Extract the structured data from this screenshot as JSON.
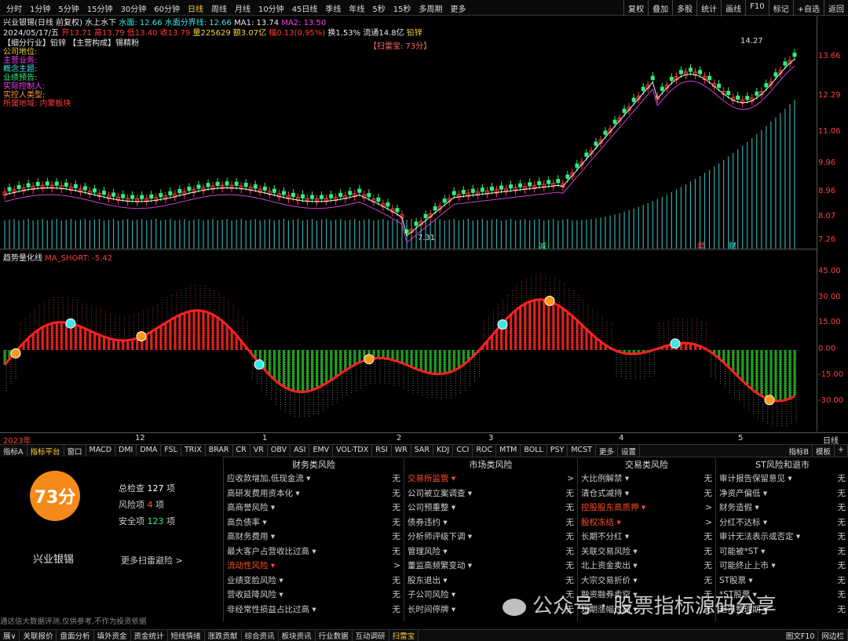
{
  "toolbar": {
    "periods": [
      "分时",
      "1分钟",
      "5分钟",
      "15分钟",
      "30分钟",
      "60分钟",
      "日线",
      "周线",
      "月线",
      "10分钟",
      "45日线",
      "季线",
      "年线",
      "5秒",
      "15秒",
      "多周期",
      "更多"
    ],
    "active_period": "日线",
    "right_buttons": [
      "复权",
      "叠加",
      "多股",
      "统计",
      "画线",
      "F10",
      "标记",
      "+自选",
      "返回"
    ]
  },
  "info1": {
    "stock": "兴业银锡(日线 前复权)",
    "indicator": "水上水下",
    "water_label": "水面: 12.66",
    "boundary_label": "水面分界线: 12.66",
    "ma1": "MA1: 13.74",
    "ma2": "MA2: 13.50"
  },
  "info2": {
    "date": "2024/05/17/五",
    "open": "开13.71",
    "high": "高13.79",
    "low": "低13.40",
    "close": "收13.79",
    "volume": "量225629",
    "amount": "额3.07亿",
    "change": "幅0.13(0.95%)",
    "turnover": "换1.53%",
    "float": "流通14.8亿",
    "tag": "铅锌"
  },
  "overlay": {
    "industry": "【细分行业】铅锌 【主营构成】锡精粉",
    "lines": [
      "公司地位:",
      "主营业务:",
      "概念主题:",
      "业绩预告:",
      "实际控制人:",
      "实控人类型:",
      "所属地域: 内蒙板块"
    ],
    "scan_badge": "【扫雷宝: 73分】",
    "high_label": "14.27",
    "low_label": "7.31",
    "markers": [
      "减",
      "增",
      "财"
    ]
  },
  "price_axis": [
    "13.66",
    "12.29",
    "11.06",
    "9.96",
    "8.96",
    "8.07",
    "7.26"
  ],
  "osc": {
    "title": "趋势量化线",
    "param": "MA_SHORT: -5.42",
    "axis": [
      "45.00",
      "30.00",
      "15.00",
      "0.00",
      "-15.00",
      "-30.00"
    ]
  },
  "date_row": {
    "labels": [
      "2023年",
      "12",
      "1",
      "2",
      "3",
      "4",
      "5"
    ],
    "right": "日线"
  },
  "index_tabs": {
    "left": [
      "指标A",
      "指标平台",
      "窗口",
      "MACD",
      "DMI",
      "DMA",
      "FSL",
      "TRIX",
      "BRAR",
      "CR",
      "VR",
      "OBV",
      "ASI",
      "EMV",
      "VOL-TDX",
      "RSI",
      "WR",
      "SAR",
      "KDJ",
      "CCI",
      "ROC",
      "MTM",
      "BOLL",
      "PSY",
      "MCST",
      "更多",
      "设置"
    ],
    "active": "指标平台",
    "right": [
      "指标B",
      "模板",
      "+"
    ]
  },
  "score": {
    "value": "73分",
    "name": "兴业银锡",
    "total_label": "总检查",
    "total": "127",
    "risk_label": "风险项",
    "risk": "4",
    "safe_label": "安全项",
    "safe": "123",
    "unit": "项",
    "more": "更多扫雷避险 >",
    "disclaimer": "通达信大数据评测,仅供参考,不作为投资依据"
  },
  "columns": [
    {
      "title": "财务类风险",
      "items": [
        {
          "label": "应收款增加,低现金流",
          "val": "无",
          "hot": false
        },
        {
          "label": "高研发费用资本化",
          "val": "无",
          "hot": false
        },
        {
          "label": "高商誉风险",
          "val": "无",
          "hot": false
        },
        {
          "label": "高负债率",
          "val": "无",
          "hot": false
        },
        {
          "label": "高财务费用",
          "val": "无",
          "hot": false
        },
        {
          "label": "最大客户占营收比过高",
          "val": "无",
          "hot": false
        },
        {
          "label": "流动性风险",
          "val": ">",
          "hot": true
        },
        {
          "label": "业绩变脸风险",
          "val": "无",
          "hot": false
        },
        {
          "label": "营收延降风险",
          "val": "无",
          "hot": false
        },
        {
          "label": "非经常性损益占比过高",
          "val": "无",
          "hot": false
        }
      ]
    },
    {
      "title": "市场类风险",
      "items": [
        {
          "label": "交易所监管",
          "val": ">",
          "hot": true
        },
        {
          "label": "公司被立案调查",
          "val": "无",
          "hot": false
        },
        {
          "label": "公司预重整",
          "val": "无",
          "hot": false
        },
        {
          "label": "债券违约",
          "val": "无",
          "hot": false
        },
        {
          "label": "分析师评级下调",
          "val": "无",
          "hot": false
        },
        {
          "label": "管理风险",
          "val": "无",
          "hot": false
        },
        {
          "label": "董监高频繁变动",
          "val": "无",
          "hot": false
        },
        {
          "label": "股东退出",
          "val": "无",
          "hot": false
        },
        {
          "label": "子公司风险",
          "val": "无",
          "hot": false
        },
        {
          "label": "长时间停牌",
          "val": "无",
          "hot": false
        }
      ]
    },
    {
      "title": "交易类风险",
      "items": [
        {
          "label": "大比例解禁",
          "val": "无",
          "hot": false
        },
        {
          "label": "清仓式减持",
          "val": "无",
          "hot": false
        },
        {
          "label": "控股股东高质押",
          "val": ">",
          "hot": true
        },
        {
          "label": "股权冻结",
          "val": ">",
          "hot": true
        },
        {
          "label": "长期不分红",
          "val": "无",
          "hot": false
        },
        {
          "label": "关联交易风险",
          "val": "无",
          "hot": false
        },
        {
          "label": "北上资金卖出",
          "val": "无",
          "hot": false
        },
        {
          "label": "大宗交易折价",
          "val": "无",
          "hot": false
        },
        {
          "label": "融资融券卖空",
          "val": "无",
          "hot": false
        },
        {
          "label": "短期涨幅过高",
          "val": "无",
          "hot": false
        }
      ]
    },
    {
      "title": "ST风险和退市",
      "items": [
        {
          "label": "审计报告保留意见",
          "val": "无",
          "hot": false
        },
        {
          "label": "净资产偏低",
          "val": "无",
          "hot": false
        },
        {
          "label": "财务造假",
          "val": "无",
          "hot": false
        },
        {
          "label": "分红不达标",
          "val": "无",
          "hot": false
        },
        {
          "label": "审计无法表示或否定",
          "val": "无",
          "hot": false
        },
        {
          "label": "可能被*ST",
          "val": "无",
          "hot": false
        },
        {
          "label": "可能终止上市",
          "val": "无",
          "hot": false
        },
        {
          "label": "ST股票",
          "val": "无",
          "hot": false
        },
        {
          "label": "*ST股票",
          "val": "无",
          "hot": false
        },
        {
          "label": "退市整理期",
          "val": "无",
          "hot": false
        }
      ]
    }
  ],
  "bottom_bar": {
    "items": [
      "展∨",
      "关联报价",
      "盘面分析",
      "填外资金",
      "资金统计",
      "短线情绪",
      "涨跌贡献",
      "综合资讯",
      "板块资讯",
      "行业数据",
      "互动调研",
      "扫雷宝"
    ],
    "active": "扫雷宝",
    "right": [
      "图文F10",
      "网边栏"
    ]
  },
  "watermark": "公众号 · 股票指标源码分享"
}
